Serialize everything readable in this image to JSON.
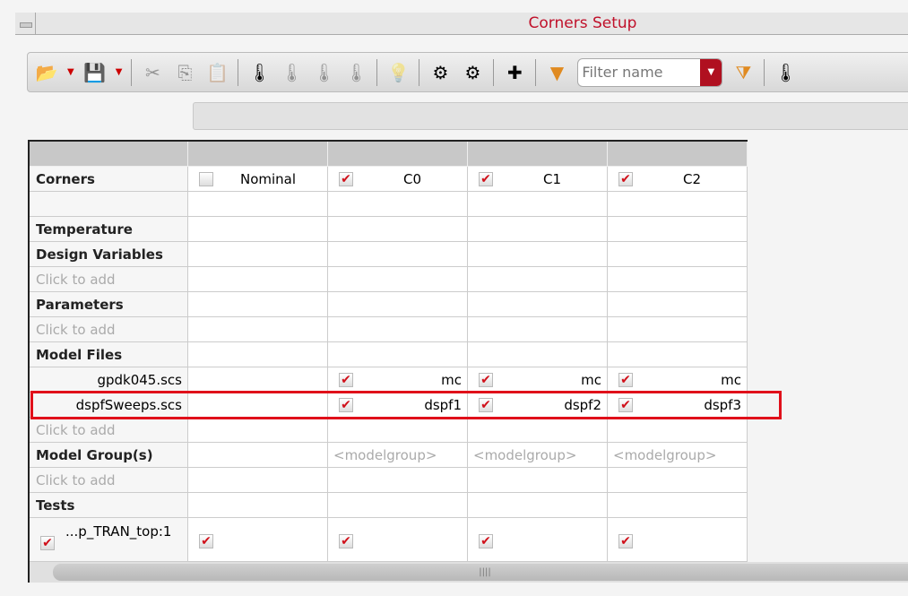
{
  "window": {
    "title": "Corners Setup"
  },
  "toolbar": {
    "filter_placeholder": "Filter name"
  },
  "table": {
    "corners_label": "Corners",
    "columns": [
      {
        "name": "Nominal",
        "checked": false
      },
      {
        "name": "C0",
        "checked": true
      },
      {
        "name": "C1",
        "checked": true
      },
      {
        "name": "C2",
        "checked": true
      }
    ],
    "temperature": "Temperature",
    "design_variables": "Design Variables",
    "click_to_add": "Click to add",
    "parameters": "Parameters",
    "model_files": "Model Files",
    "model_file_rows": [
      {
        "name": "gpdk045.scs",
        "values": [
          "mc",
          "mc",
          "mc"
        ]
      },
      {
        "name": "dspfSweeps.scs",
        "values": [
          "dspf1",
          "dspf2",
          "dspf3"
        ]
      }
    ],
    "model_groups": "Model Group(s)",
    "model_group_placeholder": "<modelgroup>",
    "tests": "Tests",
    "test_name": "...p_TRAN_top:1"
  },
  "check_mark": "✔",
  "scrollbar_grip": "||||"
}
